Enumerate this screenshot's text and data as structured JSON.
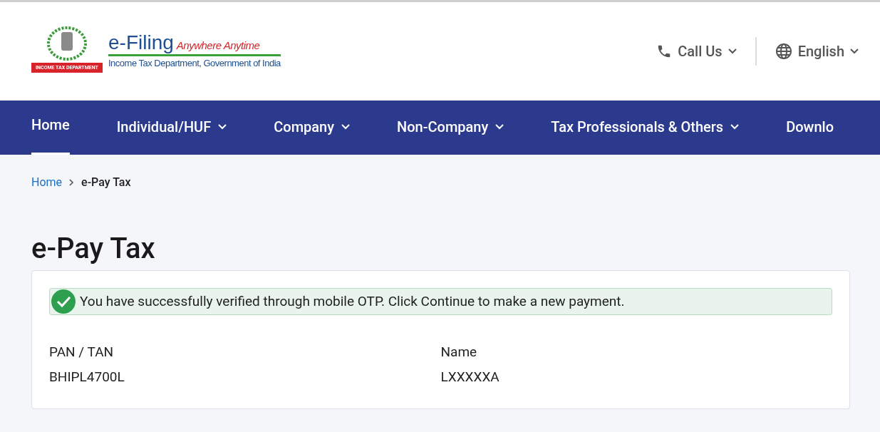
{
  "header": {
    "logo": {
      "brand": "e-Filing",
      "tagline": "Anywhere Anytime",
      "subtitle": "Income Tax Department, Government of India",
      "ribbon": "INCOME TAX DEPARTMENT"
    },
    "utilities": [
      {
        "kind": "phone",
        "label": "Call Us"
      },
      {
        "kind": "globe",
        "label": "English"
      }
    ]
  },
  "nav": [
    {
      "label": "Home",
      "selected": true,
      "dropdown": false
    },
    {
      "label": "Individual/HUF",
      "selected": false,
      "dropdown": true
    },
    {
      "label": "Company",
      "selected": false,
      "dropdown": true
    },
    {
      "label": "Non-Company",
      "selected": false,
      "dropdown": true
    },
    {
      "label": "Tax Professionals & Others",
      "selected": false,
      "dropdown": true
    },
    {
      "label": "Downlo",
      "selected": false,
      "dropdown": false
    }
  ],
  "breadcrumb": [
    {
      "label": "Home",
      "link": true
    },
    {
      "label": "e-Pay Tax",
      "link": false
    }
  ],
  "page_title": "e-Pay Tax",
  "alert": {
    "message": "You have successfully verified through mobile OTP. Click Continue to make a new payment."
  },
  "fields": [
    {
      "label": "PAN / TAN",
      "value": "BHIPL4700L"
    },
    {
      "label": "Name",
      "value": "LXXXXXA"
    }
  ]
}
